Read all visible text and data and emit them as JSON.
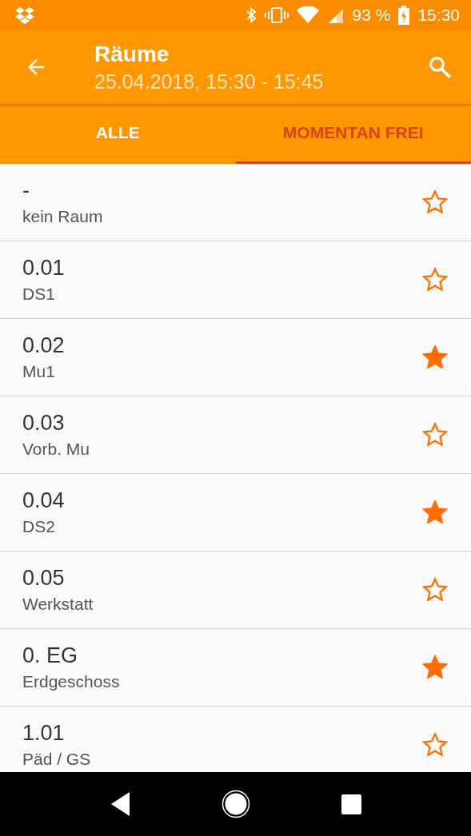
{
  "status_bar": {
    "battery": "93 %",
    "time": "15:30"
  },
  "app_bar": {
    "title": "Räume",
    "subtitle": "25.04.2018, 15:30 - 15:45"
  },
  "tabs": [
    {
      "label": "ALLE",
      "selected": false
    },
    {
      "label": "MOMENTAN FREI",
      "selected": true
    }
  ],
  "rooms": [
    {
      "number": "-",
      "name": "kein Raum",
      "starred": false
    },
    {
      "number": "0.01",
      "name": "DS1",
      "starred": false
    },
    {
      "number": "0.02",
      "name": "Mu1",
      "starred": true
    },
    {
      "number": "0.03",
      "name": "Vorb. Mu",
      "starred": false
    },
    {
      "number": "0.04",
      "name": "DS2",
      "starred": true
    },
    {
      "number": "0.05",
      "name": "Werkstatt",
      "starred": false
    },
    {
      "number": "0. EG",
      "name": "Erdgeschoss",
      "starred": true
    },
    {
      "number": "1.01",
      "name": "Päd / GS",
      "starred": false
    }
  ]
}
